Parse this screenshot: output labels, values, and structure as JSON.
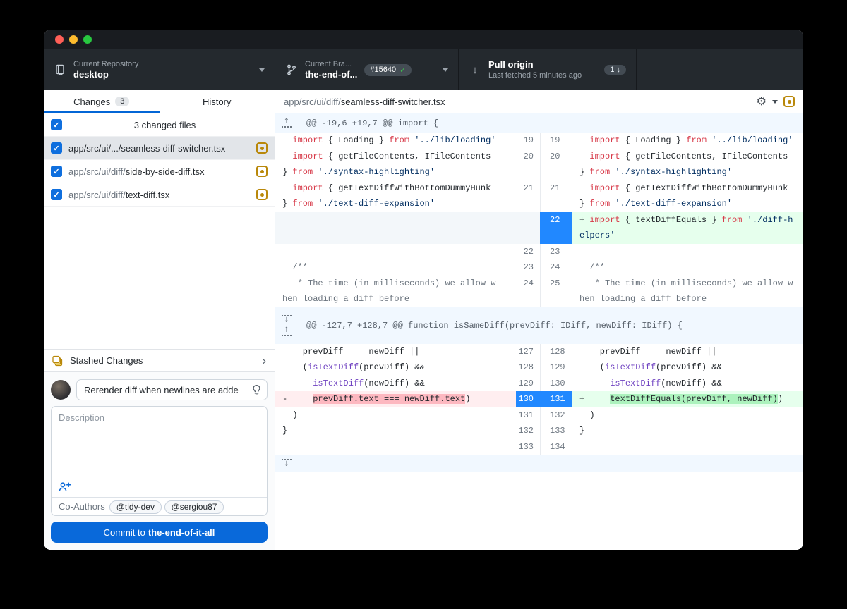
{
  "colors": {
    "accent_blue": "#0366d6",
    "commit_button_blue": "#0969da",
    "selected_line_blue": "#2188ff",
    "added_bg": "#e6ffed",
    "added_word_bg": "#acf2bd",
    "deleted_bg": "#ffeef0",
    "deleted_word_bg": "#fdb8c0",
    "modified_icon_yellow": "#b9880a",
    "toolbar_bg": "#24292e",
    "hunk_header_bg": "#f1f8ff"
  },
  "toolbar": {
    "repo": {
      "label": "Current Repository",
      "value": "desktop"
    },
    "branch": {
      "label": "Current Bra...",
      "value": "the-end-of...",
      "badge": "#15640"
    },
    "pull": {
      "title": "Pull origin",
      "subtitle": "Last fetched 5 minutes ago",
      "badge_count": "1"
    }
  },
  "sidebar": {
    "tabs": [
      {
        "label": "Changes",
        "count": "3",
        "active": true
      },
      {
        "label": "History",
        "active": false
      }
    ],
    "select_all_label": "3 changed files",
    "files": [
      {
        "dir": "app/src/ui/.../",
        "name": "seamless-diff-switcher.tsx",
        "selected": true,
        "status": "modified",
        "checked": true
      },
      {
        "dir": "app/src/ui/diff/",
        "name": "side-by-side-diff.tsx",
        "selected": false,
        "status": "modified",
        "checked": true
      },
      {
        "dir": "app/src/ui/diff/",
        "name": "text-diff.tsx",
        "selected": false,
        "status": "modified",
        "checked": true
      }
    ],
    "stashed_label": "Stashed Changes",
    "commit": {
      "summary_value": "Rerender diff when newlines are adde",
      "description_placeholder": "Description",
      "coauthors_label": "Co-Authors",
      "coauthors": [
        "@tidy-dev",
        "@sergiou87"
      ],
      "button_prefix": "Commit to ",
      "button_branch": "the-end-of-it-all"
    }
  },
  "diff": {
    "file_dir": "app/src/ui/diff/",
    "file_name": "seamless-diff-switcher.tsx",
    "hunks": [
      {
        "header": "@@ -19,6 +19,7 @@ import {",
        "expand": [
          "up"
        ],
        "rows": [
          {
            "l": {
              "n": "19",
              "t": "ctx",
              "seg": [
                [
                  "p",
                  "  "
                ],
                [
                  "k",
                  "import"
                ],
                [
                  "p",
                  " { Loading } "
                ],
                [
                  "k",
                  "from"
                ],
                [
                  "p",
                  " "
                ],
                [
                  "s",
                  "'../lib/loading'"
                ]
              ]
            },
            "r": {
              "n": "19",
              "t": "ctx",
              "seg": [
                [
                  "p",
                  "  "
                ],
                [
                  "k",
                  "import"
                ],
                [
                  "p",
                  " { Loading } "
                ],
                [
                  "k",
                  "from"
                ],
                [
                  "p",
                  " "
                ],
                [
                  "s",
                  "'../lib/loading'"
                ]
              ]
            }
          },
          {
            "l": {
              "n": "20",
              "t": "ctx",
              "seg": [
                [
                  "p",
                  "  "
                ],
                [
                  "k",
                  "import"
                ],
                [
                  "p",
                  " { getFileContents, IFileContents"
                ]
              ]
            },
            "r": {
              "n": "20",
              "t": "ctx",
              "seg": [
                [
                  "p",
                  "  "
                ],
                [
                  "k",
                  "import"
                ],
                [
                  "p",
                  " { getFileContents, IFileContents"
                ]
              ]
            }
          },
          {
            "l": {
              "n": "",
              "t": "ctx",
              "seg": [
                [
                  "p",
                  "} "
                ],
                [
                  "k",
                  "from"
                ],
                [
                  "p",
                  " "
                ],
                [
                  "s",
                  "'./syntax-highlighting'"
                ]
              ]
            },
            "r": {
              "n": "",
              "t": "ctx",
              "seg": [
                [
                  "p",
                  "} "
                ],
                [
                  "k",
                  "from"
                ],
                [
                  "p",
                  " "
                ],
                [
                  "s",
                  "'./syntax-highlighting'"
                ]
              ]
            }
          },
          {
            "l": {
              "n": "21",
              "t": "ctx",
              "seg": [
                [
                  "p",
                  "  "
                ],
                [
                  "k",
                  "import"
                ],
                [
                  "p",
                  " { getTextDiffWithBottomDummyHunk"
                ]
              ]
            },
            "r": {
              "n": "21",
              "t": "ctx",
              "seg": [
                [
                  "p",
                  "  "
                ],
                [
                  "k",
                  "import"
                ],
                [
                  "p",
                  " { getTextDiffWithBottomDummyHunk"
                ]
              ]
            }
          },
          {
            "l": {
              "n": "",
              "t": "ctx",
              "seg": [
                [
                  "p",
                  "} "
                ],
                [
                  "k",
                  "from"
                ],
                [
                  "p",
                  " "
                ],
                [
                  "s",
                  "'./text-diff-expansion'"
                ]
              ]
            },
            "r": {
              "n": "",
              "t": "ctx",
              "seg": [
                [
                  "p",
                  "} "
                ],
                [
                  "k",
                  "from"
                ],
                [
                  "p",
                  " "
                ],
                [
                  "s",
                  "'./text-diff-expansion'"
                ]
              ]
            }
          },
          {
            "l": {
              "n": "",
              "t": "ph",
              "seg": []
            },
            "r": {
              "n": "22",
              "t": "add",
              "sel": true,
              "seg": [
                [
                  "p",
                  "+ "
                ],
                [
                  "k",
                  "import"
                ],
                [
                  "p",
                  " { textDiffEquals } "
                ],
                [
                  "k",
                  "from"
                ],
                [
                  "p",
                  " "
                ],
                [
                  "s",
                  "'./diff-h"
                ]
              ]
            }
          },
          {
            "l": {
              "n": "",
              "t": "ph",
              "seg": []
            },
            "r": {
              "n": "",
              "t": "add",
              "sel": true,
              "seg": [
                [
                  "s",
                  "elpers'"
                ]
              ]
            }
          },
          {
            "l": {
              "n": "22",
              "t": "ctx",
              "seg": []
            },
            "r": {
              "n": "23",
              "t": "ctx",
              "seg": []
            }
          },
          {
            "l": {
              "n": "23",
              "t": "ctx",
              "seg": [
                [
                  "c",
                  "  /**"
                ]
              ]
            },
            "r": {
              "n": "24",
              "t": "ctx",
              "seg": [
                [
                  "c",
                  "  /**"
                ]
              ]
            }
          },
          {
            "l": {
              "n": "24",
              "t": "ctx",
              "seg": [
                [
                  "c",
                  "   * The time (in milliseconds) we allow w"
                ]
              ]
            },
            "r": {
              "n": "25",
              "t": "ctx",
              "seg": [
                [
                  "c",
                  "   * The time (in milliseconds) we allow w"
                ]
              ]
            }
          },
          {
            "l": {
              "n": "",
              "t": "ctx",
              "seg": [
                [
                  "c",
                  "hen loading a diff before"
                ]
              ]
            },
            "r": {
              "n": "",
              "t": "ctx",
              "seg": [
                [
                  "c",
                  "hen loading a diff before"
                ]
              ]
            }
          }
        ]
      },
      {
        "header": "@@ -127,7 +128,7 @@ function isSameDiff(prevDiff: IDiff, newDiff: IDiff) {",
        "expand": [
          "down",
          "up"
        ],
        "rows": [
          {
            "l": {
              "n": "127",
              "t": "ctx",
              "seg": [
                [
                  "p",
                  "    prevDiff === newDiff ||"
                ]
              ]
            },
            "r": {
              "n": "128",
              "t": "ctx",
              "seg": [
                [
                  "p",
                  "    prevDiff === newDiff ||"
                ]
              ]
            }
          },
          {
            "l": {
              "n": "128",
              "t": "ctx",
              "seg": [
                [
                  "p",
                  "    ("
                ],
                [
                  "f",
                  "isTextDiff"
                ],
                [
                  "p",
                  "(prevDiff) &&"
                ]
              ]
            },
            "r": {
              "n": "129",
              "t": "ctx",
              "seg": [
                [
                  "p",
                  "    ("
                ],
                [
                  "f",
                  "isTextDiff"
                ],
                [
                  "p",
                  "(prevDiff) &&"
                ]
              ]
            }
          },
          {
            "l": {
              "n": "129",
              "t": "ctx",
              "seg": [
                [
                  "p",
                  "      "
                ],
                [
                  "f",
                  "isTextDiff"
                ],
                [
                  "p",
                  "(newDiff) &&"
                ]
              ]
            },
            "r": {
              "n": "130",
              "t": "ctx",
              "seg": [
                [
                  "p",
                  "      "
                ],
                [
                  "f",
                  "isTextDiff"
                ],
                [
                  "p",
                  "(newDiff) &&"
                ]
              ]
            }
          },
          {
            "l": {
              "n": "130",
              "t": "del",
              "sel": true,
              "seg": [
                [
                  "p",
                  "-     "
                ],
                [
                  "h",
                  "prevDiff.text === newDiff.text"
                ],
                [
                  "p",
                  ")"
                ]
              ]
            },
            "r": {
              "n": "131",
              "t": "add",
              "sel": true,
              "seg": [
                [
                  "p",
                  "+     "
                ],
                [
                  "h",
                  "textDiffEquals(prevDiff, newDiff)"
                ],
                [
                  "p",
                  ")"
                ]
              ]
            }
          },
          {
            "l": {
              "n": "131",
              "t": "ctx",
              "seg": [
                [
                  "p",
                  "  )"
                ]
              ]
            },
            "r": {
              "n": "132",
              "t": "ctx",
              "seg": [
                [
                  "p",
                  "  )"
                ]
              ]
            }
          },
          {
            "l": {
              "n": "132",
              "t": "ctx",
              "seg": [
                [
                  "p",
                  "}"
                ]
              ]
            },
            "r": {
              "n": "133",
              "t": "ctx",
              "seg": [
                [
                  "p",
                  "}"
                ]
              ]
            }
          },
          {
            "l": {
              "n": "133",
              "t": "ctx",
              "seg": []
            },
            "r": {
              "n": "134",
              "t": "ctx",
              "seg": []
            }
          }
        ]
      }
    ]
  }
}
